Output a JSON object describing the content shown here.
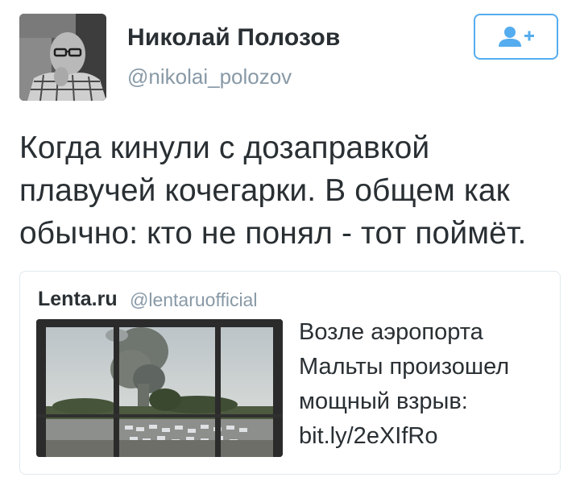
{
  "tweet": {
    "author": {
      "name": "Николай Полозов",
      "handle": "@nikolai_polozov",
      "avatar_icon": "profile-photo"
    },
    "follow_button": {
      "icon": "add-user-icon",
      "accent": "#55acee"
    },
    "text": "Когда кинули с дозаправкой\nплавучей кочегарки. В общем как\nобычно: кто не понял - тот поймёт."
  },
  "quoted_tweet": {
    "author_name": "Lenta.ru",
    "handle": "@lentaruofficial",
    "text": "Возле аэропорта\nМальты произошел\nмощный взрыв:\nbit.ly/2eXIfRo",
    "image_icon": "explosion-photo"
  },
  "colors": {
    "text": "#292f33",
    "muted": "#8899a6",
    "accent": "#55acee",
    "border": "#e1e8ed"
  }
}
